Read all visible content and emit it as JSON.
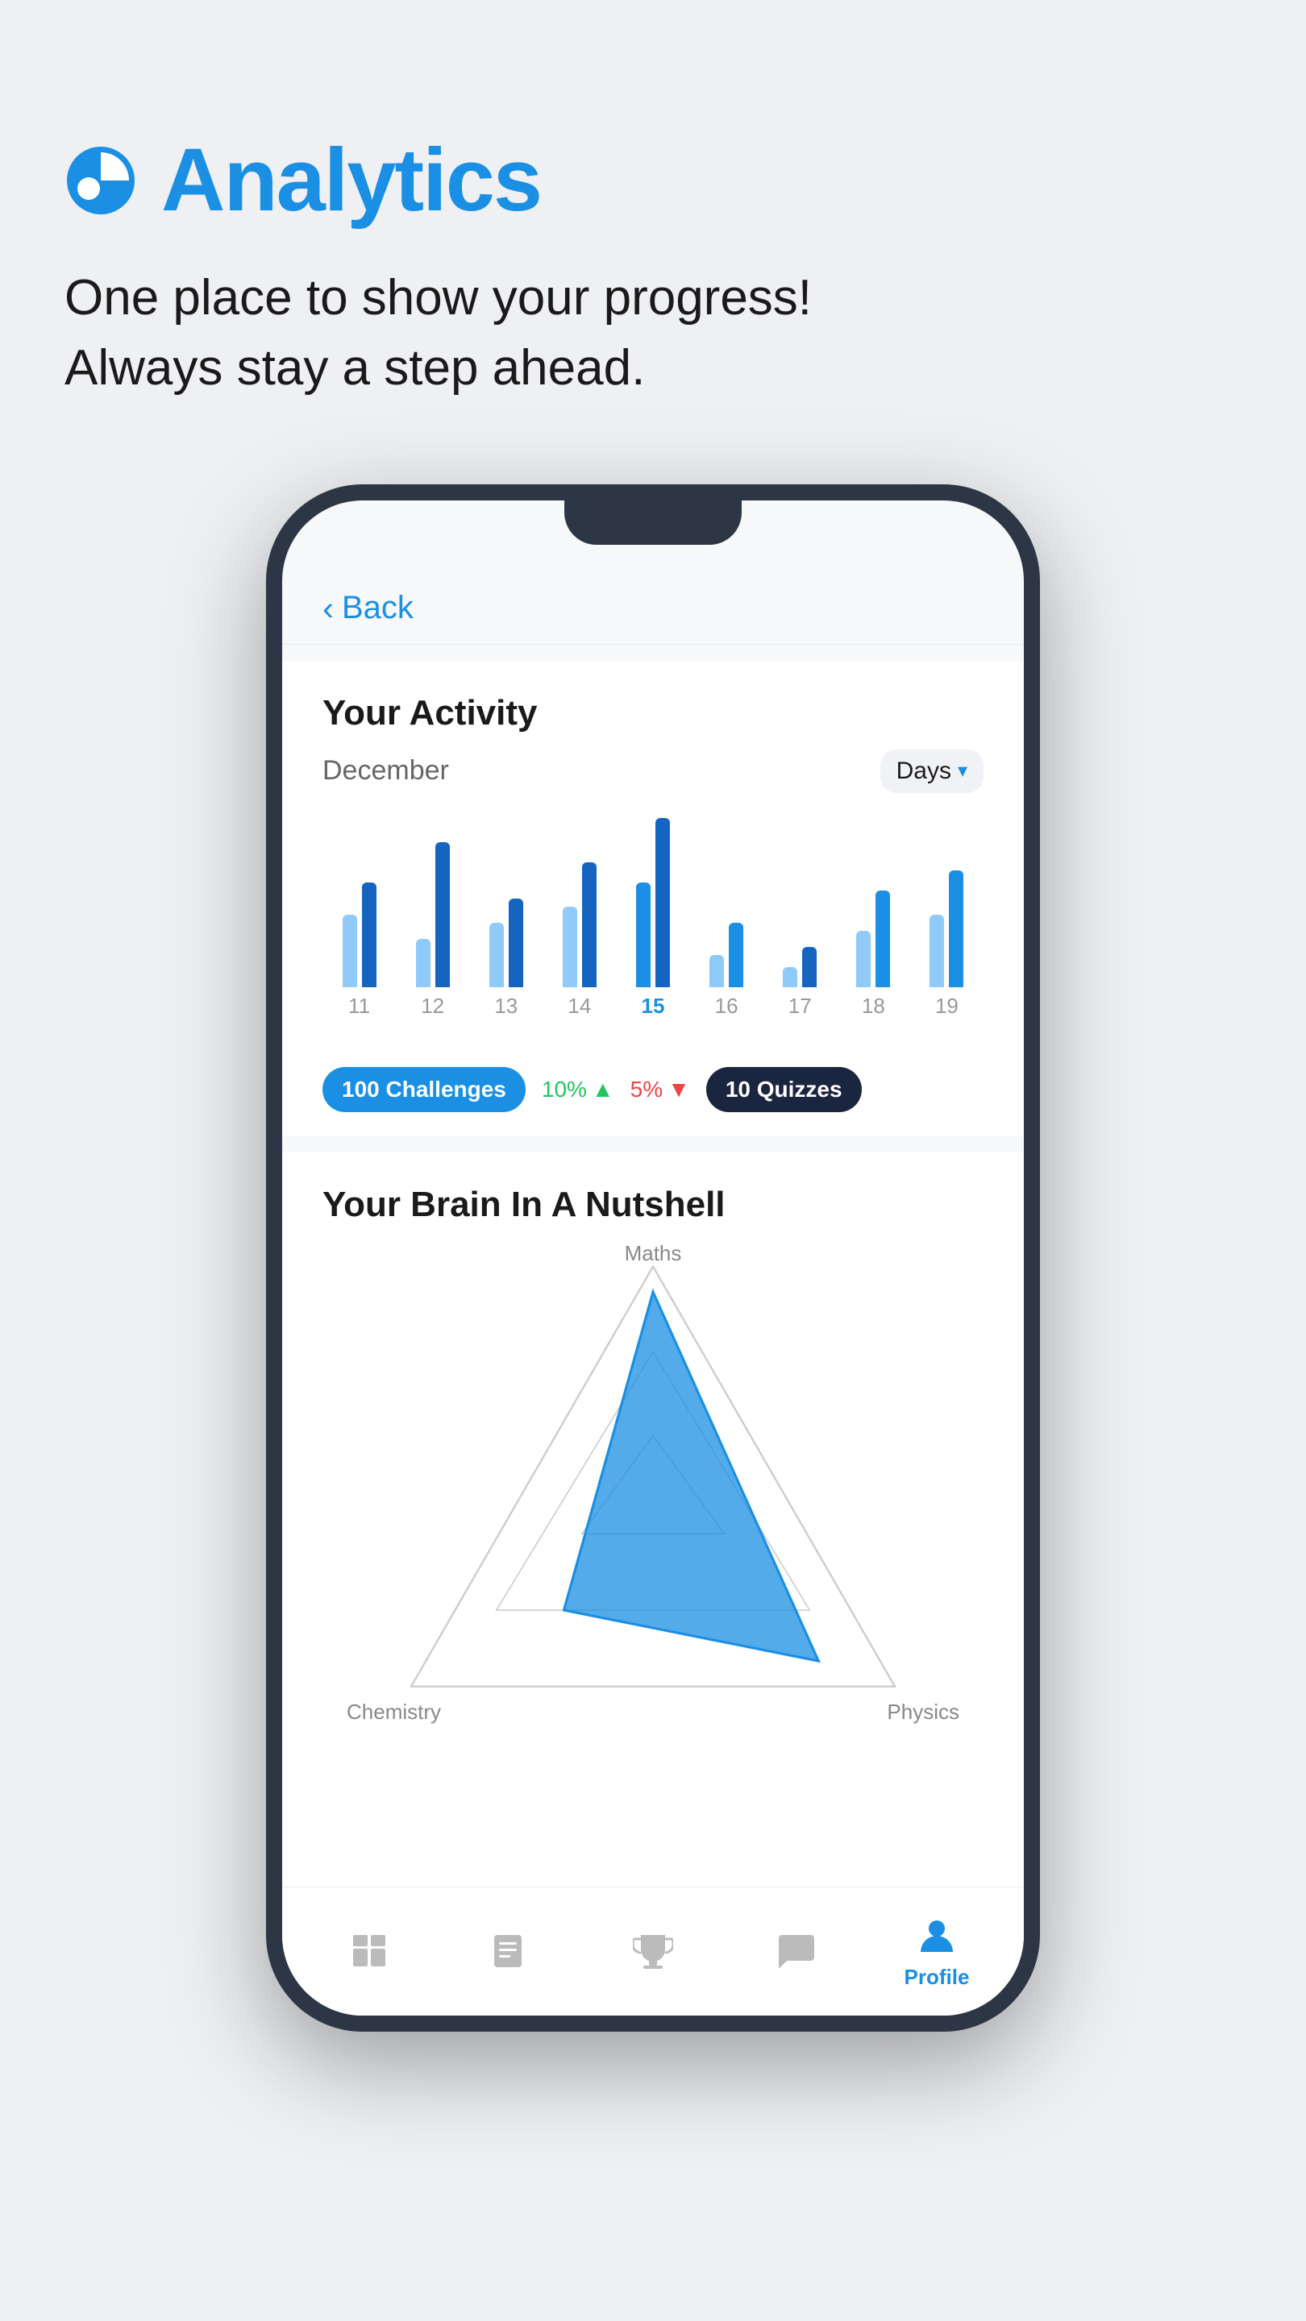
{
  "header": {
    "title": "Analytics",
    "subtitle_line1": "One place to show your progress!",
    "subtitle_line2": "Always stay a step ahead."
  },
  "screen": {
    "back_label": "Back",
    "activity": {
      "title": "Your Activity",
      "month": "December",
      "period": "Days",
      "bars": [
        {
          "day": "11",
          "height1": 130,
          "height2": 90,
          "active": false
        },
        {
          "day": "12",
          "height1": 180,
          "height2": 60,
          "active": false
        },
        {
          "day": "13",
          "height1": 110,
          "height2": 80,
          "active": false
        },
        {
          "day": "14",
          "height1": 150,
          "height2": 100,
          "active": false
        },
        {
          "day": "15",
          "height1": 200,
          "height2": 130,
          "active": true
        },
        {
          "day": "16",
          "height1": 80,
          "height2": 50,
          "active": false
        },
        {
          "day": "17",
          "height1": 60,
          "height2": 30,
          "active": false
        },
        {
          "day": "18",
          "height1": 120,
          "height2": 70,
          "active": false
        },
        {
          "day": "19",
          "height1": 140,
          "height2": 90,
          "active": false
        }
      ],
      "stats": {
        "challenges": "100 Challenges",
        "change_up": "10%",
        "change_down": "5%",
        "quizzes": "10 Quizzes"
      }
    },
    "brain": {
      "title": "Your Brain In A Nutshell",
      "labels": {
        "top": "Maths",
        "bottom_left": "Chemistry",
        "bottom_right": "Physics"
      }
    },
    "bottom_nav": [
      {
        "icon": "home-icon",
        "label": "",
        "active": false
      },
      {
        "icon": "book-icon",
        "label": "",
        "active": false
      },
      {
        "icon": "trophy-icon",
        "label": "",
        "active": false
      },
      {
        "icon": "chat-icon",
        "label": "",
        "active": false
      },
      {
        "icon": "profile-icon",
        "label": "Profile",
        "active": true
      }
    ]
  }
}
